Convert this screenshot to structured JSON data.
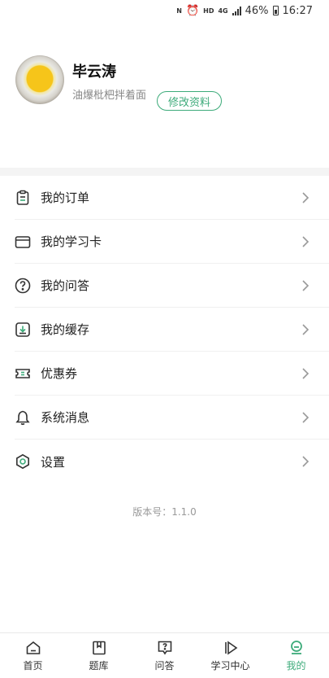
{
  "status_bar": {
    "nfc": "N",
    "hd": "HD",
    "network": "4G",
    "battery_percent": "46%",
    "time": "16:27"
  },
  "profile": {
    "name": "毕云涛",
    "signature": "油爆枇杷拌着面",
    "edit_label": "修改资料"
  },
  "menu": {
    "items": [
      {
        "label": "我的订单",
        "icon": "order-icon"
      },
      {
        "label": "我的学习卡",
        "icon": "card-icon"
      },
      {
        "label": "我的问答",
        "icon": "question-icon"
      },
      {
        "label": "我的缓存",
        "icon": "download-icon"
      },
      {
        "label": "优惠券",
        "icon": "coupon-icon"
      },
      {
        "label": "系统消息",
        "icon": "bell-icon"
      },
      {
        "label": "设置",
        "icon": "settings-icon"
      }
    ]
  },
  "version_text": "版本号：1.1.0",
  "tabbar": {
    "tabs": [
      {
        "label": "首页",
        "icon": "home-icon"
      },
      {
        "label": "题库",
        "icon": "question-bank-icon"
      },
      {
        "label": "问答",
        "icon": "qa-icon"
      },
      {
        "label": "学习中心",
        "icon": "play-icon"
      },
      {
        "label": "我的",
        "icon": "profile-icon",
        "active": true
      }
    ],
    "active_color": "#3dab7a"
  },
  "colors": {
    "accent": "#3dab7a",
    "icon": "#333333"
  }
}
